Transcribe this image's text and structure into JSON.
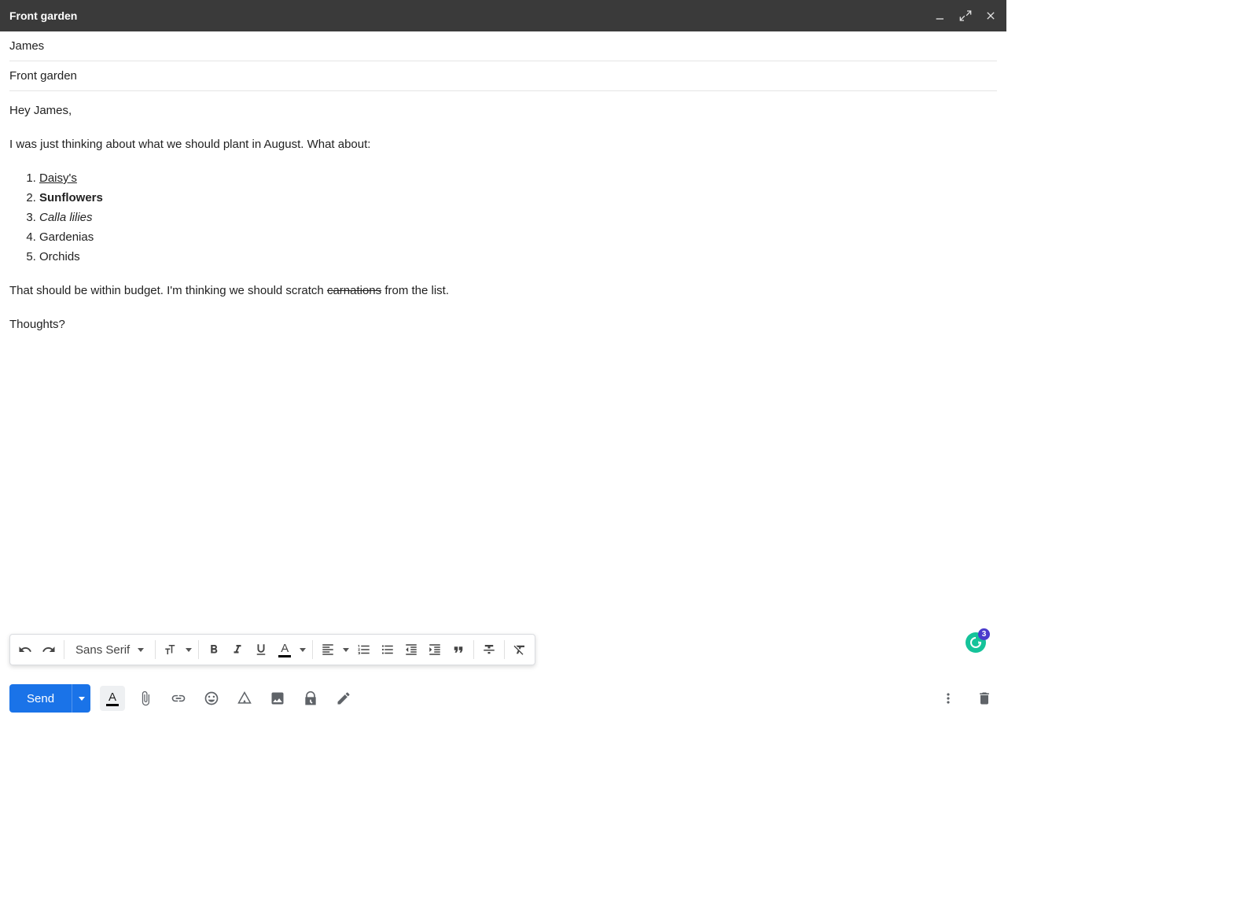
{
  "titlebar": {
    "title": "Front garden"
  },
  "fields": {
    "to": "James",
    "subject": "Front garden"
  },
  "body": {
    "greeting": "Hey James,",
    "intro": "I was just thinking about what we should plant in August. What about:",
    "list": {
      "item1": "Daisy's",
      "item2": "Sunflowers",
      "item3": "Calla lilies",
      "item4": "Gardenias",
      "item5": "Orchids"
    },
    "budget_pre": "That should be within budget. I'm thinking we should scratch ",
    "budget_strike": "carnations",
    "budget_post": " from the list.",
    "closing": "Thoughts?"
  },
  "toolbar": {
    "font_name": "Sans Serif"
  },
  "bottom": {
    "send_label": "Send"
  },
  "grammarly": {
    "count": "3"
  }
}
